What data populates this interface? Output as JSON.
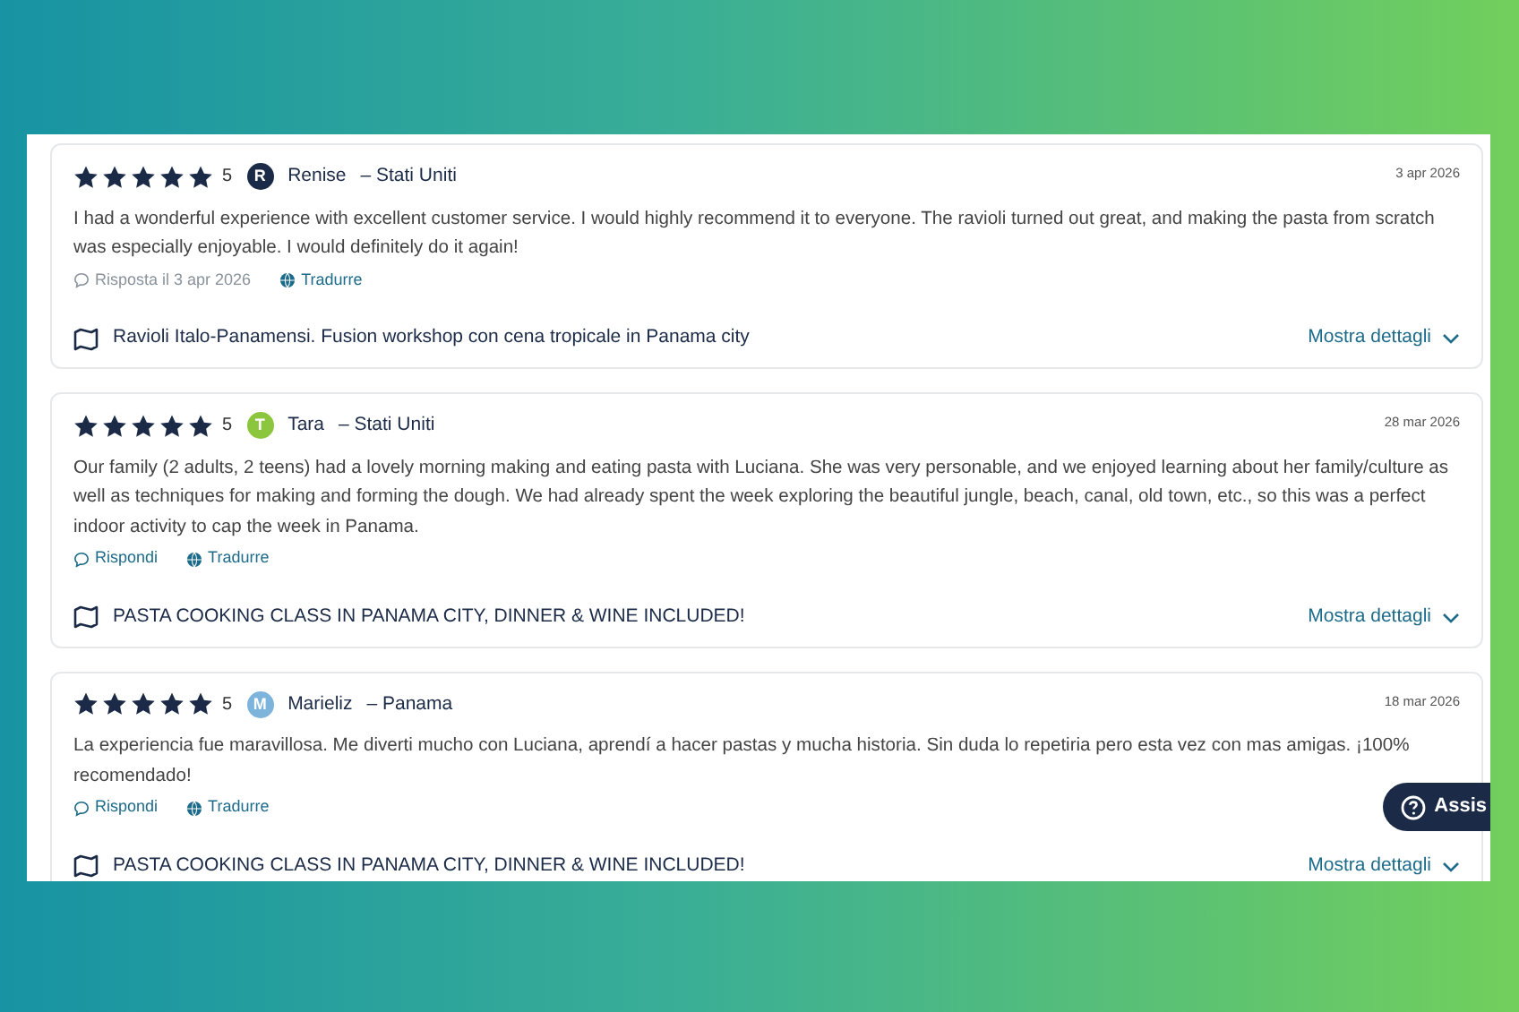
{
  "reviews": [
    {
      "stars": 5,
      "rating": "5",
      "avatar_letter": "R",
      "color": "#1b2a47",
      "author": "Renise",
      "country": "– Stati Uniti",
      "date": "3 apr 2026",
      "text": "I had a wonderful experience with excellent customer service. I would highly recommend it to everyone. The ravioli turned out great, and making the pasta from scratch was especially enjoyable. I would definitely do it again!",
      "reply": "Risposta il 3 apr 2026",
      "reply_disabled": true,
      "translate": "Tradurre",
      "product": "Ravioli Italo-Panamensi. Fusion workshop con cena tropicale in Panama city",
      "details": "Mostra dettagli"
    },
    {
      "stars": 5,
      "rating": "5",
      "avatar_letter": "T",
      "color": "#8cc63f",
      "author": "Tara",
      "country": "– Stati Uniti",
      "date": "28 mar 2026",
      "text": "Our family (2 adults, 2 teens) had a lovely morning making and eating pasta with Luciana. She was very personable, and we enjoyed learning about her family/culture as well as techniques for making and forming the dough. We had already spent the week exploring the beautiful jungle, beach, canal, old town, etc., so this was a perfect indoor activity to cap the week in Panama.",
      "reply": "Rispondi",
      "reply_disabled": false,
      "translate": "Tradurre",
      "product": "PASTA COOKING CLASS IN PANAMA CITY, DINNER & WINE INCLUDED!",
      "details": "Mostra dettagli"
    },
    {
      "stars": 5,
      "rating": "5",
      "avatar_letter": "M",
      "color": "#7db4dc",
      "author": "Marieliz",
      "country": "– Panama",
      "date": "18 mar 2026",
      "text": "La experiencia fue maravillosa. Me diverti mucho con Luciana, aprendí a hacer pastas y mucha historia. Sin duda lo repetiria pero esta vez con mas amigas. ¡100% recomendado!",
      "reply": "Rispondi",
      "reply_disabled": false,
      "translate": "Tradurre",
      "product": "PASTA COOKING CLASS IN PANAMA CITY, DINNER & WINE INCLUDED!",
      "details": "Mostra dettagli"
    }
  ],
  "help_button": {
    "label": "Assis"
  }
}
